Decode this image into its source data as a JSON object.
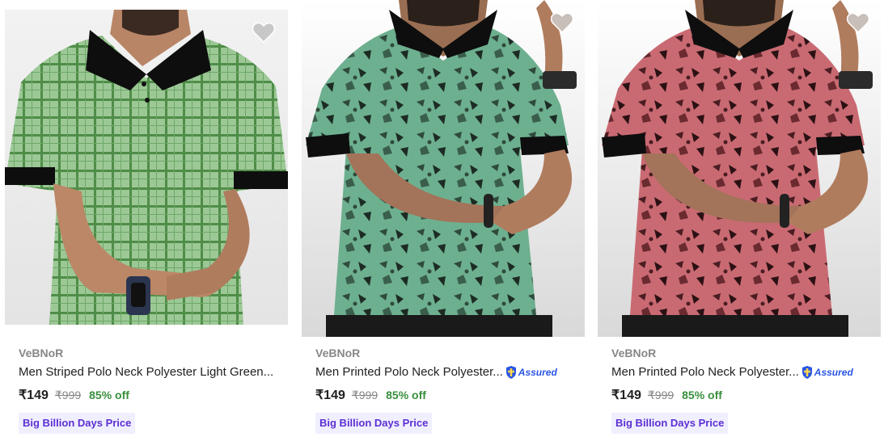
{
  "products": [
    {
      "brand": "VeBNoR",
      "title": "Men Striped Polo Neck Polyester Light Green...",
      "assured": false,
      "price": "₹149",
      "mrp": "₹999",
      "discount": "85% off",
      "badge": "Big Billion Days Price",
      "shirt_color": "#8fc08a",
      "pattern": "checks"
    },
    {
      "brand": "VeBNoR",
      "title": "Men Printed Polo Neck Polyester...",
      "assured": true,
      "assured_label": "Assured",
      "price": "₹149",
      "mrp": "₹999",
      "discount": "85% off",
      "badge": "Big Billion Days Price",
      "shirt_color": "#6db08f",
      "pattern": "camo"
    },
    {
      "brand": "VeBNoR",
      "title": "Men Printed Polo Neck Polyester...",
      "assured": true,
      "assured_label": "Assured",
      "price": "₹149",
      "mrp": "₹999",
      "discount": "85% off",
      "badge": "Big Billion Days Price",
      "shirt_color": "#c96a72",
      "pattern": "camo"
    }
  ],
  "colors": {
    "price_text": "#212121",
    "brand_text": "#878787",
    "discount": "#388e3c",
    "badge_bg": "#f0efff",
    "badge_text": "#5b2fd1",
    "assured_blue": "#2a55e5"
  }
}
